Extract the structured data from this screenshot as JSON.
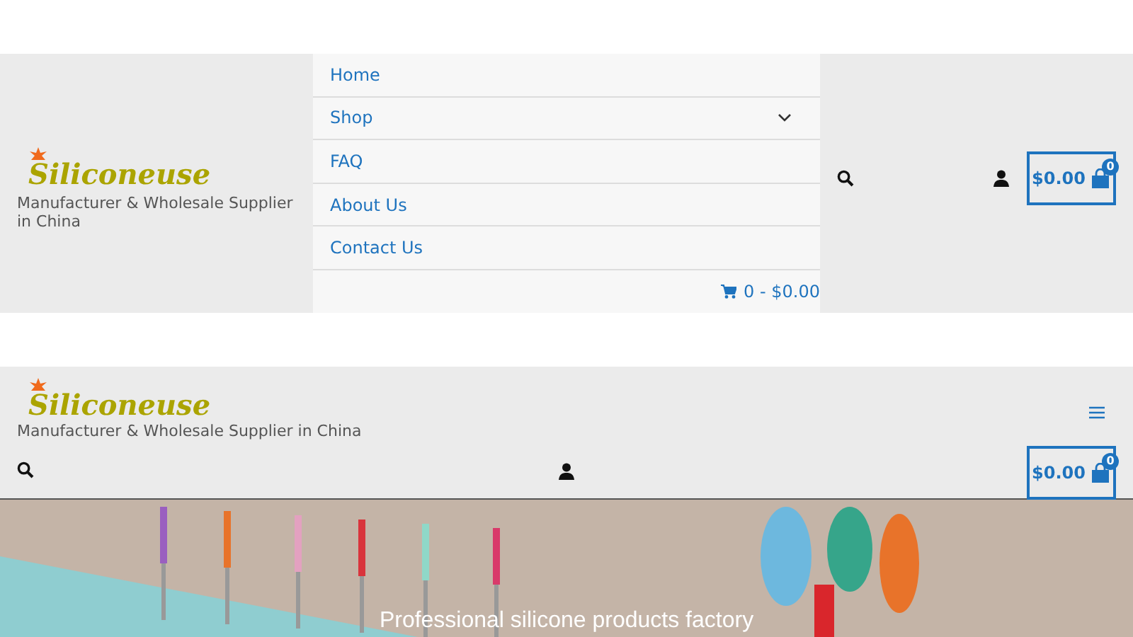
{
  "desktop_header": {
    "logo": "Siliconeuse",
    "tagline": "Manufacturer & Wholesale Supplier in China",
    "menu": [
      {
        "label": "Home",
        "expandable": false
      },
      {
        "label": "Shop",
        "expandable": true
      },
      {
        "label": "FAQ",
        "expandable": false
      },
      {
        "label": "About Us",
        "expandable": false
      },
      {
        "label": "Contact Us",
        "expandable": false
      }
    ],
    "menu_cart": "0 - $0.00",
    "cart_button": {
      "total": "$0.00",
      "badge": "0"
    }
  },
  "mobile_header": {
    "logo": "Siliconeuse",
    "tagline": "Manufacturer & Wholesale Supplier in China",
    "cart_button": {
      "total": "$0.00",
      "badge": "0"
    }
  },
  "banner": {
    "caption": "Professional silicone products factory"
  }
}
